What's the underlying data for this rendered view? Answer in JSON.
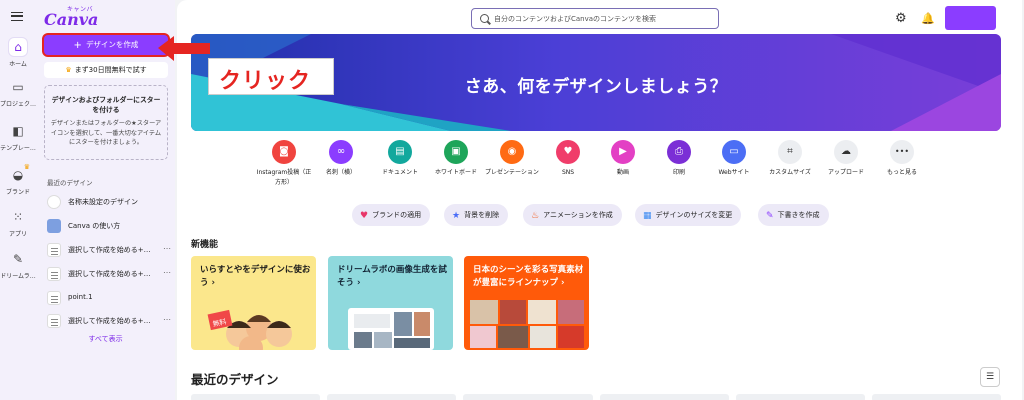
{
  "rail": {
    "items": [
      {
        "label": "ホーム",
        "icon": "home-icon",
        "glyph": "⌂"
      },
      {
        "label": "プロジェク…",
        "icon": "folder-icon",
        "glyph": "▭"
      },
      {
        "label": "テンプレー…",
        "icon": "template-icon",
        "glyph": "◧"
      },
      {
        "label": "ブランド",
        "icon": "brand-icon",
        "glyph": "◒"
      },
      {
        "label": "アプリ",
        "icon": "apps-icon",
        "glyph": "⁙"
      },
      {
        "label": "ドリームラ…",
        "icon": "dream-lab-icon",
        "glyph": "✎"
      }
    ]
  },
  "sidebar": {
    "logo_kana": "キャンバ",
    "logo_word": "Canva",
    "create_button": "デザインを作成",
    "trial_text": "まず30日間無料で試す",
    "tip_title": "デザインおよびフォルダーにスターを付ける",
    "tip_body": "デザインまたはフォルダーの★スターアイコンを選択して、一番大切なアイテムにスターを付けましょう。",
    "recent_heading": "最近のデザイン",
    "recent_items": [
      {
        "label": "名称未設定のデザイン",
        "thumb": "blank"
      },
      {
        "label": "Canva の使い方",
        "thumb": "canva"
      },
      {
        "label": "選択して作成を始める+…",
        "thumb": "doc"
      },
      {
        "label": "選択して作成を始める+…",
        "thumb": "doc"
      },
      {
        "label": "point.1",
        "thumb": "doc"
      },
      {
        "label": "選択して作成を始める+…",
        "thumb": "doc"
      }
    ],
    "see_all": "すべて表示"
  },
  "callout": {
    "text": "クリック",
    "color": "#e52521"
  },
  "header": {
    "search_placeholder": "自分のコンテンツおよびCanvaのコンテンツを検索"
  },
  "banner": {
    "headline": "さあ、何をデザインしましょう？"
  },
  "quick_actions": [
    {
      "label": "Instagram投稿（正方形）",
      "color": "#f0443f",
      "glyph": "◙"
    },
    {
      "label": "名刺（横）",
      "color": "#8b3dff",
      "glyph": "∞"
    },
    {
      "label": "ドキュメント",
      "color": "#12a89d",
      "glyph": "▤"
    },
    {
      "label": "ホワイトボード",
      "color": "#1ea55a",
      "glyph": "▣"
    },
    {
      "label": "プレゼンテーション",
      "color": "#ff6a13",
      "glyph": "◉"
    },
    {
      "label": "SNS",
      "color": "#f03d6a",
      "glyph": "♥"
    },
    {
      "label": "動画",
      "color": "#e340c4",
      "glyph": "▶"
    },
    {
      "label": "印刷",
      "color": "#7b2fd6",
      "glyph": "⎙"
    },
    {
      "label": "Webサイト",
      "color": "#4c6ef5",
      "glyph": "▭"
    },
    {
      "label": "カスタムサイズ",
      "color": "#eceef1",
      "glyph": "⌗"
    },
    {
      "label": "アップロード",
      "color": "#eceef1",
      "glyph": "☁"
    },
    {
      "label": "もっと見る",
      "color": "#eceef1",
      "glyph": "•••"
    }
  ],
  "chips": [
    {
      "label": "ブランドの適用",
      "glyph": "♥",
      "color": "#e8376a"
    },
    {
      "label": "背景を削除",
      "glyph": "★",
      "color": "#4a6cf7"
    },
    {
      "label": "アニメーションを作成",
      "glyph": "♨",
      "color": "#f25a1a"
    },
    {
      "label": "デザインのサイズを変更",
      "glyph": "▦",
      "color": "#3d8bf2"
    },
    {
      "label": "下書きを作成",
      "glyph": "✎",
      "color": "#8b3dff"
    }
  ],
  "new_features": {
    "title": "新機能",
    "cards": [
      {
        "title": "いらすとやをデザインに使おう ›",
        "badge": "無料"
      },
      {
        "title": "ドリームラボの画像生成を試そう ›"
      },
      {
        "title": "日本のシーンを彩る写真素材が豊富にラインナップ ›"
      }
    ]
  },
  "recent_section": {
    "title": "最近のデザイン"
  },
  "colors": {
    "brand": "#8b3dff",
    "accent_red": "#e52521",
    "sidebar_bg": "#f3f0fb"
  }
}
